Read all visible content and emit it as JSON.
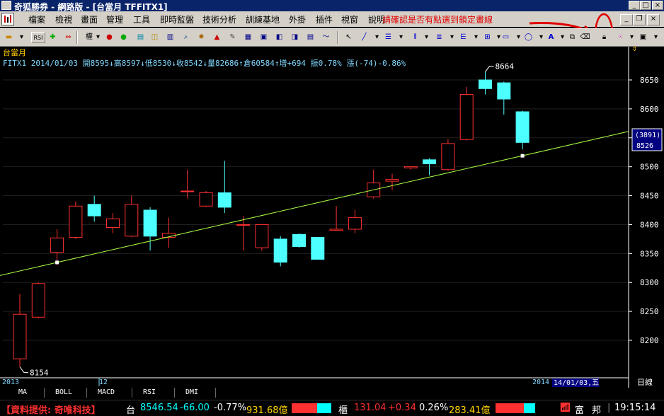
{
  "window": {
    "title": "奇狐勝券 - 網路版 - [台當月 TFFITX1]",
    "annotation": "請確認是否有點選到鎖定畫線"
  },
  "menu": [
    "檔案",
    "檢視",
    "畫面",
    "管理",
    "工具",
    "即時監盤",
    "技術分析",
    "訓練基地",
    "外掛",
    "插件",
    "視窗",
    "說明"
  ],
  "toolbar": {
    "rsi_label": "RSI",
    "weight_label": "權"
  },
  "chart": {
    "symbol_label": "台當月",
    "info_line": "FITX1 2014/01/03 開8595↓高8597↓低8530↓收8542↓量82686↑倉60584↑增+694 振0.78% 漲(-74)-0.86%",
    "price_box_top": "(3891)",
    "price_box_bottom": "8526",
    "ylabels": [
      "8650",
      "8600",
      "8550",
      "8500",
      "8450",
      "8400",
      "8350",
      "8300",
      "8250",
      "8200"
    ],
    "high_label": "8664",
    "low_label": "8154",
    "xlabel_2013": "2013",
    "xlabel_12": "12",
    "xlabel_2014": "2014",
    "cursor_date": "14/01/03,五",
    "period_button": "日線",
    "indicator_tabs": [
      "MA",
      "BOLL",
      "MACD",
      "RSI",
      "DMI"
    ]
  },
  "chart_data": {
    "type": "candlestick",
    "ylim": [
      8150,
      8700
    ],
    "candles": [
      {
        "o": 8168,
        "h": 8280,
        "l": 8154,
        "c": 8245
      },
      {
        "o": 8240,
        "h": 8300,
        "l": 8238,
        "c": 8298
      },
      {
        "o": 8352,
        "h": 8392,
        "l": 8330,
        "c": 8377
      },
      {
        "o": 8378,
        "h": 8440,
        "l": 8375,
        "c": 8432
      },
      {
        "o": 8435,
        "h": 8450,
        "l": 8405,
        "c": 8415
      },
      {
        "o": 8395,
        "h": 8420,
        "l": 8385,
        "c": 8410
      },
      {
        "o": 8380,
        "h": 8450,
        "l": 8378,
        "c": 8435
      },
      {
        "o": 8425,
        "h": 8430,
        "l": 8355,
        "c": 8380
      },
      {
        "o": 8378,
        "h": 8412,
        "l": 8360,
        "c": 8385
      },
      {
        "o": 8458,
        "h": 8495,
        "l": 8445,
        "c": 8458
      },
      {
        "o": 8432,
        "h": 8458,
        "l": 8430,
        "c": 8455
      },
      {
        "o": 8455,
        "h": 8510,
        "l": 8420,
        "c": 8430
      },
      {
        "o": 8400,
        "h": 8415,
        "l": 8355,
        "c": 8400
      },
      {
        "o": 8360,
        "h": 8400,
        "l": 8355,
        "c": 8400
      },
      {
        "o": 8375,
        "h": 8380,
        "l": 8328,
        "c": 8335
      },
      {
        "o": 8383,
        "h": 8385,
        "l": 8360,
        "c": 8362
      },
      {
        "o": 8378,
        "h": 8378,
        "l": 8340,
        "c": 8340
      },
      {
        "o": 8390,
        "h": 8432,
        "l": 8390,
        "c": 8392
      },
      {
        "o": 8392,
        "h": 8425,
        "l": 8385,
        "c": 8412
      },
      {
        "o": 8448,
        "h": 8495,
        "l": 8445,
        "c": 8472
      },
      {
        "o": 8475,
        "h": 8488,
        "l": 8460,
        "c": 8478
      },
      {
        "o": 8498,
        "h": 8500,
        "l": 8495,
        "c": 8500
      },
      {
        "o": 8512,
        "h": 8515,
        "l": 8485,
        "c": 8505
      },
      {
        "o": 8495,
        "h": 8548,
        "l": 8493,
        "c": 8540
      },
      {
        "o": 8547,
        "h": 8638,
        "l": 8545,
        "c": 8625
      },
      {
        "o": 8650,
        "h": 8664,
        "l": 8625,
        "c": 8635
      },
      {
        "o": 8645,
        "h": 8647,
        "l": 8590,
        "c": 8617
      },
      {
        "o": 8595,
        "h": 8597,
        "l": 8530,
        "c": 8542
      }
    ],
    "trendline": {
      "y_start": 8312,
      "y_end": 8561
    }
  },
  "status": {
    "provider": "【資料提供: 奇唯科技】",
    "tai_label": "台",
    "tai_value": "8546.54",
    "tai_change": "-66.00",
    "tai_pct": "-0.77%",
    "tai_volume": "931.68億",
    "otc_label": "櫃",
    "otc_value": "131.04",
    "otc_change": "+0.34",
    "otc_pct": "0.26%",
    "otc_volume": "283.41億",
    "broker1": "富",
    "broker2": "邦",
    "time": "19:15:14"
  },
  "colors": {
    "up": "#ff3030",
    "down": "#4dffff",
    "trend": "#aaff44",
    "info": "#7fd7ff",
    "status_yellow": "#ffd400",
    "status_cyan": "#00ffff"
  }
}
